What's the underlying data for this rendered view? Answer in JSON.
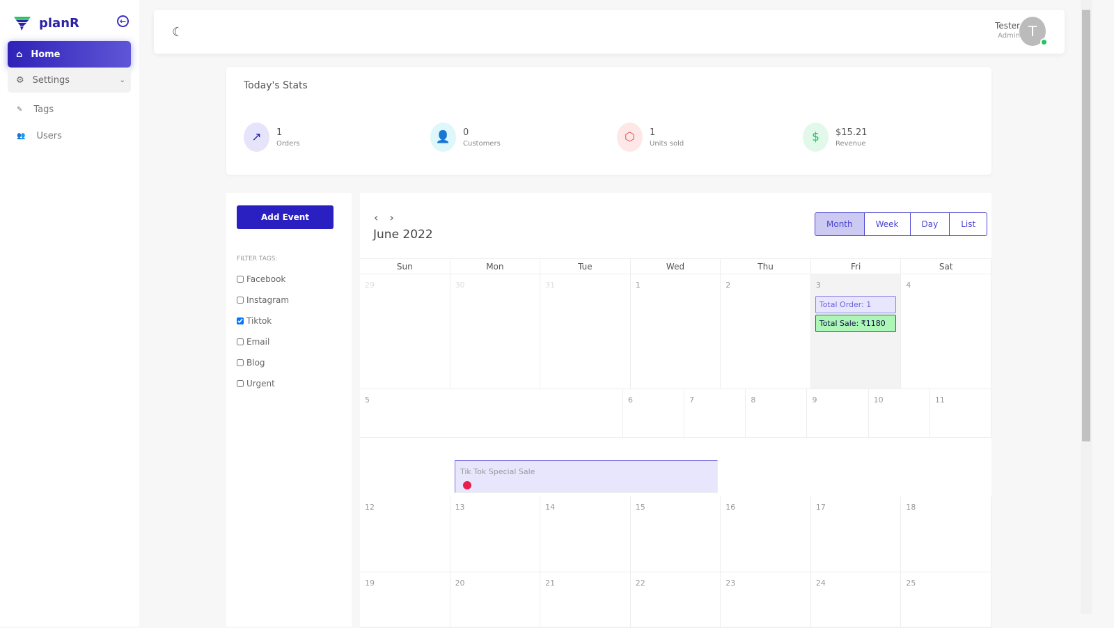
{
  "app": {
    "name": "planR"
  },
  "sidebar": {
    "items": [
      {
        "label": "Home"
      },
      {
        "label": "Settings"
      },
      {
        "label": "Tags"
      },
      {
        "label": "Users"
      }
    ]
  },
  "user": {
    "name": "Tester",
    "role": "Admin",
    "initial": "T"
  },
  "stats": {
    "title": "Today's Stats",
    "items": [
      {
        "value": "1",
        "label": "Orders"
      },
      {
        "value": "0",
        "label": "Customers"
      },
      {
        "value": "1",
        "label": "Units sold"
      },
      {
        "value": "$15.21",
        "label": "Revenue"
      }
    ]
  },
  "events_panel": {
    "add_label": "Add Event",
    "filter_title": "FILTER TAGS:",
    "tags": [
      {
        "label": "Facebook",
        "checked": false
      },
      {
        "label": "Instagram",
        "checked": false
      },
      {
        "label": "Tiktok",
        "checked": true
      },
      {
        "label": "Email",
        "checked": false
      },
      {
        "label": "Blog",
        "checked": false
      },
      {
        "label": "Urgent",
        "checked": false
      }
    ]
  },
  "calendar": {
    "title": "June 2022",
    "views": [
      "Month",
      "Week",
      "Day",
      "List"
    ],
    "active_view": "Month",
    "weekdays": [
      "Sun",
      "Mon",
      "Tue",
      "Wed",
      "Thu",
      "Fri",
      "Sat"
    ],
    "weeks": [
      [
        "29",
        "30",
        "31",
        "1",
        "2",
        "3",
        "4"
      ],
      [
        "5",
        "6",
        "7",
        "8",
        "9",
        "10",
        "11"
      ],
      [
        "12",
        "13",
        "14",
        "15",
        "16",
        "17",
        "18"
      ],
      [
        "19",
        "20",
        "21",
        "22",
        "23",
        "24",
        "25"
      ]
    ],
    "events": {
      "total_order": "Total Order: 1",
      "total_sale": "Total Sale: ₹1180",
      "tiktok_sale": "Tik Tok Special Sale"
    }
  }
}
